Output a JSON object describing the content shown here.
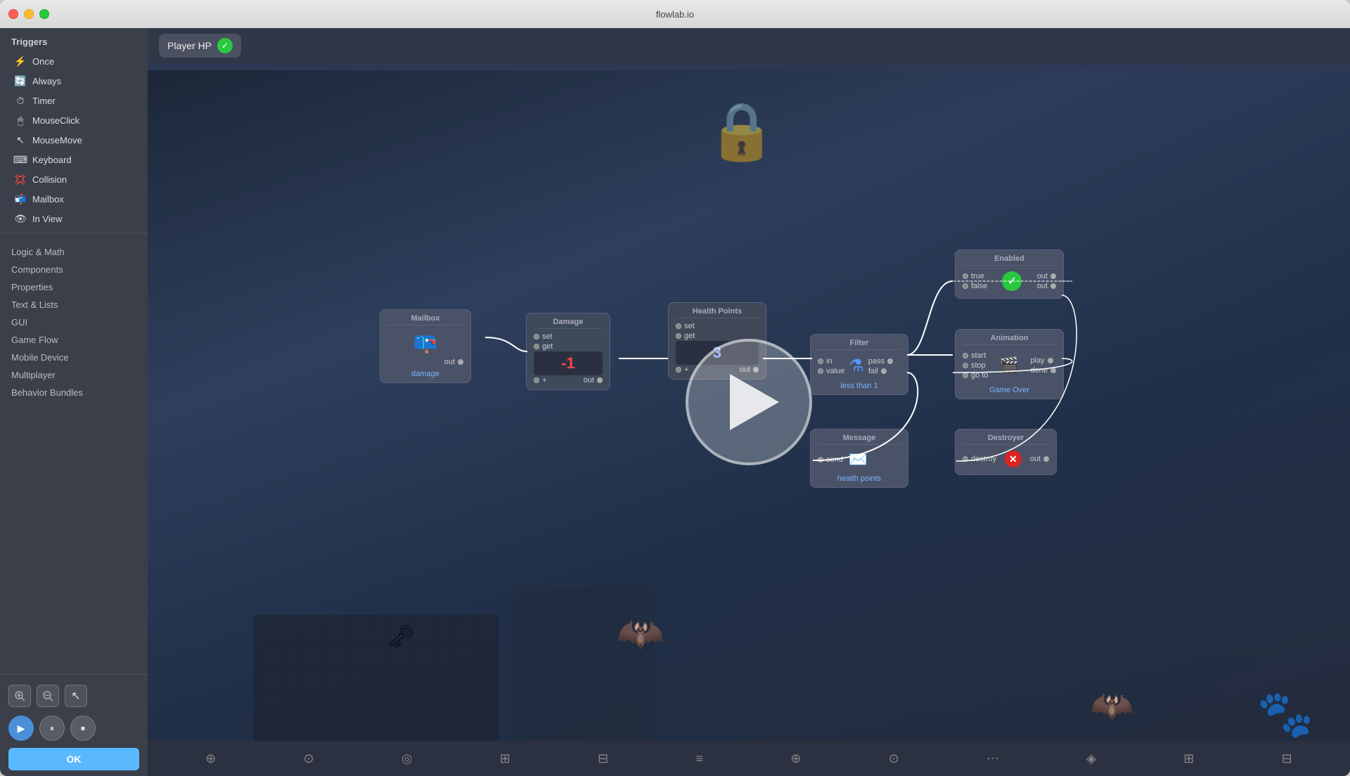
{
  "window": {
    "title": "flowlab.io"
  },
  "sidebar": {
    "triggers_section": "Triggers",
    "triggers": [
      {
        "id": "once",
        "label": "Once",
        "icon": "⚡"
      },
      {
        "id": "always",
        "label": "Always",
        "icon": "🔄"
      },
      {
        "id": "timer",
        "label": "Timer",
        "icon": "⏱"
      },
      {
        "id": "mouseclick",
        "label": "MouseClick",
        "icon": "🖱"
      },
      {
        "id": "mousemove",
        "label": "MouseMove",
        "icon": "↖"
      },
      {
        "id": "keyboard",
        "label": "Keyboard",
        "icon": "⌨"
      },
      {
        "id": "collision",
        "label": "Collision",
        "icon": "💢"
      },
      {
        "id": "mailbox",
        "label": "Mailbox",
        "icon": "📬"
      },
      {
        "id": "inview",
        "label": "In View",
        "icon": "👁"
      }
    ],
    "categories": [
      {
        "id": "logic-math",
        "label": "Logic & Math"
      },
      {
        "id": "components",
        "label": "Components"
      },
      {
        "id": "properties",
        "label": "Properties"
      },
      {
        "id": "text-lists",
        "label": "Text & Lists"
      },
      {
        "id": "gui",
        "label": "GUI"
      },
      {
        "id": "game-flow",
        "label": "Game Flow"
      },
      {
        "id": "mobile-device",
        "label": "Mobile Device"
      },
      {
        "id": "multiplayer",
        "label": "Multiplayer"
      },
      {
        "id": "behavior-bundles",
        "label": "Behavior Bundles"
      }
    ],
    "ok_label": "OK"
  },
  "canvas": {
    "header": {
      "player_hp_label": "Player HP"
    },
    "nodes": {
      "mailbox": {
        "title": "Mailbox",
        "port_out": "out",
        "label": "damage"
      },
      "damage": {
        "title": "Damage",
        "port_set": "set",
        "port_get": "get",
        "port_plus": "+",
        "port_out": "out",
        "value": "-1"
      },
      "health_points": {
        "title": "Health Points",
        "port_set": "set",
        "port_get": "get",
        "port_plus": "+",
        "port_out": "out",
        "value": "3"
      },
      "filter": {
        "title": "Filter",
        "port_in": "in",
        "port_value": "value",
        "port_pass": "pass",
        "port_fail": "fail",
        "label": "less than 1"
      },
      "enabled": {
        "title": "Enabled",
        "port_true": "true",
        "port_false": "false",
        "port_out1": "out",
        "port_out2": "out"
      },
      "animation": {
        "title": "Animation",
        "port_start": "start",
        "port_stop": "stop",
        "port_go_to": "go to",
        "port_play": "play",
        "port_done": "done",
        "label": "Game Over"
      },
      "message": {
        "title": "Message",
        "port_send": "send",
        "label": "health points"
      },
      "destroyer": {
        "title": "Destroyer",
        "port_destroy": "destroy",
        "port_out": "out"
      }
    }
  },
  "icons": {
    "close": "✕",
    "minimize": "−",
    "maximize": "+",
    "play_triangle": "▶",
    "pause": "⏸",
    "stop": "⏹",
    "zoom_in": "🔍",
    "zoom_out": "🔍",
    "check": "✓",
    "filter_symbol": "⚗",
    "animation_symbol": "🎬",
    "message_envelope": "✉",
    "destroy_x": "✕",
    "mailbox_symbol": "📪",
    "cursor": "↖"
  },
  "colors": {
    "accent_blue": "#5ab8ff",
    "green_check": "#27c93f",
    "node_bg": "#4a5268",
    "canvas_bg": "#3d4558",
    "sidebar_bg": "#3a3f4a",
    "damage_red": "#ff4444",
    "hp_blue": "#88aaff"
  }
}
